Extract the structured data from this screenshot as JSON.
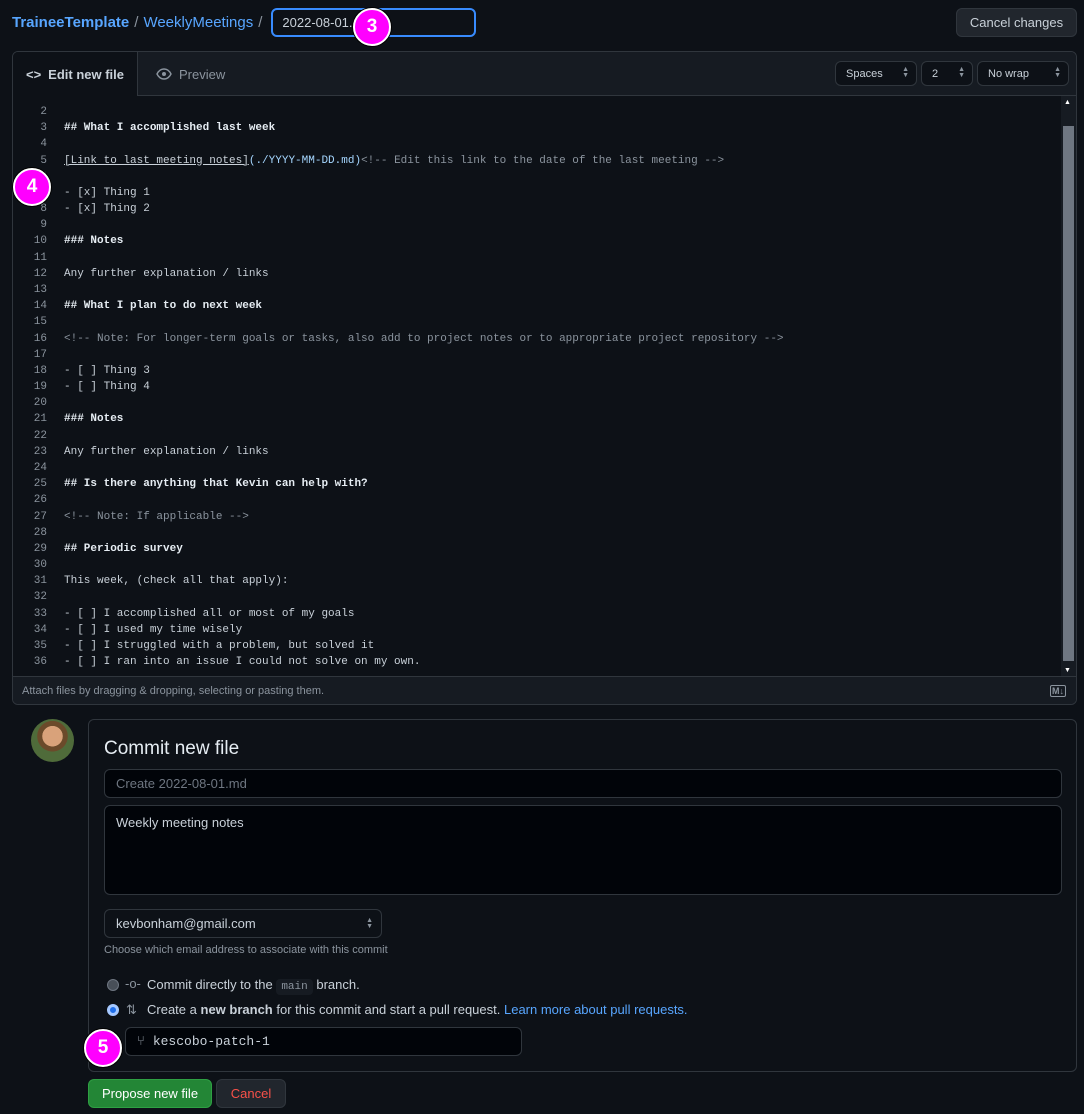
{
  "breadcrumb": {
    "repo": "TraineeTemplate",
    "folder": "WeeklyMeetings",
    "sep": "/",
    "filename": "2022-08-01.md"
  },
  "cancel_changes": "Cancel changes",
  "tabs": {
    "edit": "Edit new file",
    "preview": "Preview"
  },
  "options": {
    "indent_mode": "Spaces",
    "indent_size": "2",
    "wrap": "No wrap"
  },
  "code_lines": [
    {
      "n": "2",
      "t": "",
      "k": ""
    },
    {
      "n": "3",
      "t": "## What I accomplished last week",
      "k": "h"
    },
    {
      "n": "4",
      "t": "",
      "k": ""
    },
    {
      "n": "5",
      "t": "",
      "k": "link"
    },
    {
      "n": "6",
      "t": "",
      "k": ""
    },
    {
      "n": "7",
      "t": "- [x] Thing 1",
      "k": ""
    },
    {
      "n": "8",
      "t": "- [x] Thing 2",
      "k": ""
    },
    {
      "n": "9",
      "t": "",
      "k": ""
    },
    {
      "n": "10",
      "t": "### Notes",
      "k": "h"
    },
    {
      "n": "11",
      "t": "",
      "k": ""
    },
    {
      "n": "12",
      "t": "Any further explanation / links",
      "k": ""
    },
    {
      "n": "13",
      "t": "",
      "k": ""
    },
    {
      "n": "14",
      "t": "## What I plan to do next week",
      "k": "h"
    },
    {
      "n": "15",
      "t": "",
      "k": ""
    },
    {
      "n": "16",
      "t": "<!-- Note: For longer-term goals or tasks, also add to project notes or to appropriate project repository -->",
      "k": "c"
    },
    {
      "n": "17",
      "t": "",
      "k": ""
    },
    {
      "n": "18",
      "t": "- [ ] Thing 3",
      "k": ""
    },
    {
      "n": "19",
      "t": "- [ ] Thing 4",
      "k": ""
    },
    {
      "n": "20",
      "t": "",
      "k": ""
    },
    {
      "n": "21",
      "t": "### Notes",
      "k": "h"
    },
    {
      "n": "22",
      "t": "",
      "k": ""
    },
    {
      "n": "23",
      "t": "Any further explanation / links",
      "k": ""
    },
    {
      "n": "24",
      "t": "",
      "k": ""
    },
    {
      "n": "25",
      "t": "## Is there anything that Kevin can help with?",
      "k": "h"
    },
    {
      "n": "26",
      "t": "",
      "k": ""
    },
    {
      "n": "27",
      "t": "<!-- Note: If applicable -->",
      "k": "c"
    },
    {
      "n": "28",
      "t": "",
      "k": ""
    },
    {
      "n": "29",
      "t": "## Periodic survey",
      "k": "h"
    },
    {
      "n": "30",
      "t": "",
      "k": ""
    },
    {
      "n": "31",
      "t": "This week, (check all that apply):",
      "k": ""
    },
    {
      "n": "32",
      "t": "",
      "k": ""
    },
    {
      "n": "33",
      "t": "- [ ] I accomplished all or most of my goals",
      "k": ""
    },
    {
      "n": "34",
      "t": "- [ ] I used my time wisely",
      "k": ""
    },
    {
      "n": "35",
      "t": "- [ ] I struggled with a problem, but solved it",
      "k": ""
    },
    {
      "n": "36",
      "t": "- [ ] I ran into an issue I could not solve on my own.",
      "k": ""
    }
  ],
  "line5": {
    "link_text": "[Link to last meeting notes]",
    "url": "(./YYYY-MM-DD.md)",
    "comment": "<!-- Edit this link to the date of the last meeting -->"
  },
  "attach_hint": "Attach files by dragging & dropping, selecting or pasting them.",
  "commit": {
    "title": "Commit new file",
    "summary_placeholder": "Create 2022-08-01.md",
    "description": "Weekly meeting notes",
    "email": "kevbonham@gmail.com",
    "email_hint": "Choose which email address to associate with this commit",
    "direct_pre": "Commit directly to the",
    "direct_branch": "main",
    "direct_post": "branch.",
    "new_pre": "Create a",
    "new_bold": "new branch",
    "new_post": "for this commit and start a pull request.",
    "learn_more": "Learn more about pull requests.",
    "branch_name": "kescobo-patch-1",
    "selected_option": "new branch"
  },
  "buttons": {
    "propose": "Propose new file",
    "cancel": "Cancel"
  },
  "markers": [
    "3",
    "4",
    "5"
  ],
  "colors": {
    "link": "#58a6ff",
    "primary": "#238636",
    "danger": "#f85149",
    "marker": "#ff00ff"
  }
}
